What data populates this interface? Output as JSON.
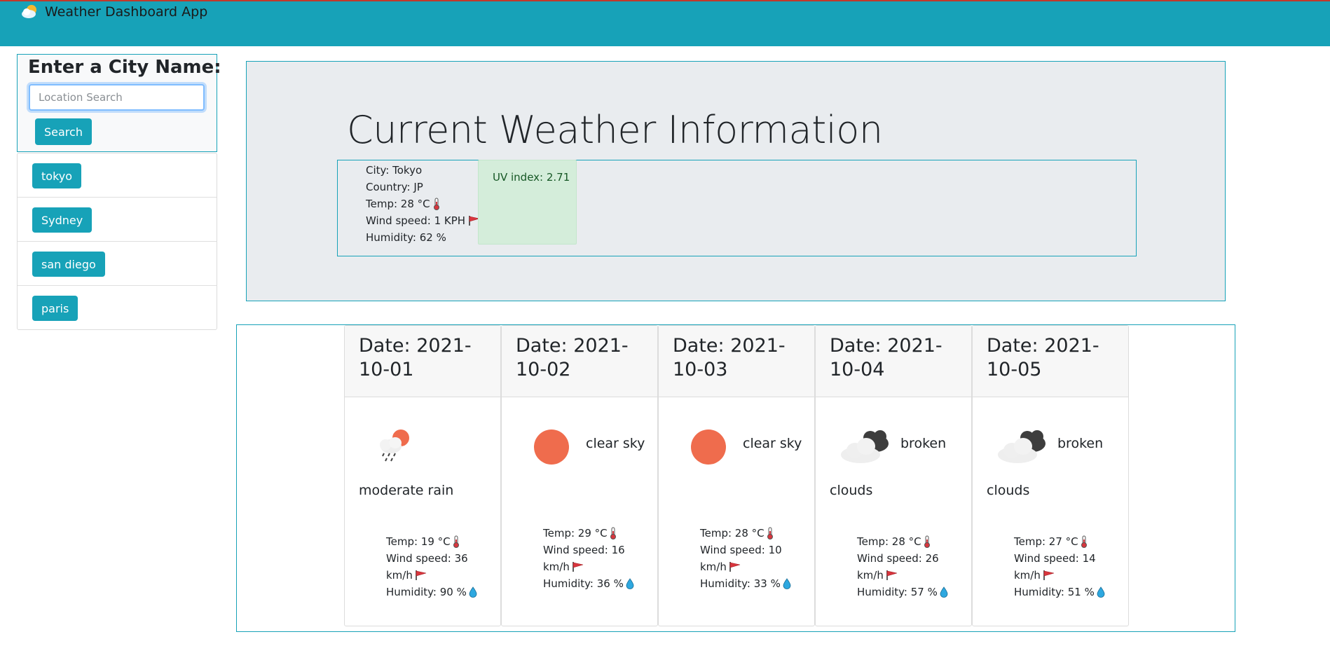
{
  "app": {
    "title": "Weather Dashboard App"
  },
  "search": {
    "heading": "Enter a City Name:",
    "placeholder": "Location Search",
    "button_label": "Search"
  },
  "history": [
    "tokyo",
    "Sydney",
    "san diego",
    "paris"
  ],
  "current": {
    "title": "Current Weather Information",
    "city_line": "City: Tokyo",
    "country_line": "Country: JP",
    "temp_line": "Temp: 28 °C",
    "wind_line": "Wind speed: 1 KPH",
    "humidity_line": "Humidity: 62 %",
    "uv_line": "UV index: 2.71"
  },
  "forecast": [
    {
      "date": "Date: 2021-10-01",
      "icon": "rain-sun-icon",
      "desc": "",
      "desc2": "moderate rain",
      "temp": "Temp: 19 °C",
      "wind": "Wind speed: 36",
      "wind_unit": "km/h",
      "humidity": "Humidity: 90 %"
    },
    {
      "date": "Date: 2021-10-02",
      "icon": "sun-icon",
      "desc": "clear sky",
      "desc2": "",
      "temp": "Temp: 29 °C",
      "wind": "Wind speed: 16",
      "wind_unit": "km/h",
      "humidity": "Humidity: 36 %"
    },
    {
      "date": "Date: 2021-10-03",
      "icon": "sun-icon",
      "desc": "clear sky",
      "desc2": "",
      "temp": "Temp: 28 °C",
      "wind": "Wind speed: 10",
      "wind_unit": "km/h",
      "humidity": "Humidity: 33 %"
    },
    {
      "date": "Date: 2021-10-04",
      "icon": "broken-clouds-icon",
      "desc": "broken",
      "desc2": "clouds",
      "temp": "Temp: 28 °C",
      "wind": "Wind speed: 26",
      "wind_unit": "km/h",
      "humidity": "Humidity: 57 %"
    },
    {
      "date": "Date: 2021-10-05",
      "icon": "broken-clouds-icon",
      "desc": "broken",
      "desc2": "clouds",
      "temp": "Temp: 27 °C",
      "wind": "Wind speed: 14",
      "wind_unit": "km/h",
      "humidity": "Humidity: 51 %"
    }
  ],
  "colors": {
    "accent": "#17a2b8",
    "uv_background": "#d4edda",
    "sun": "#ef6c4d",
    "panel_background": "#e9ecef"
  }
}
